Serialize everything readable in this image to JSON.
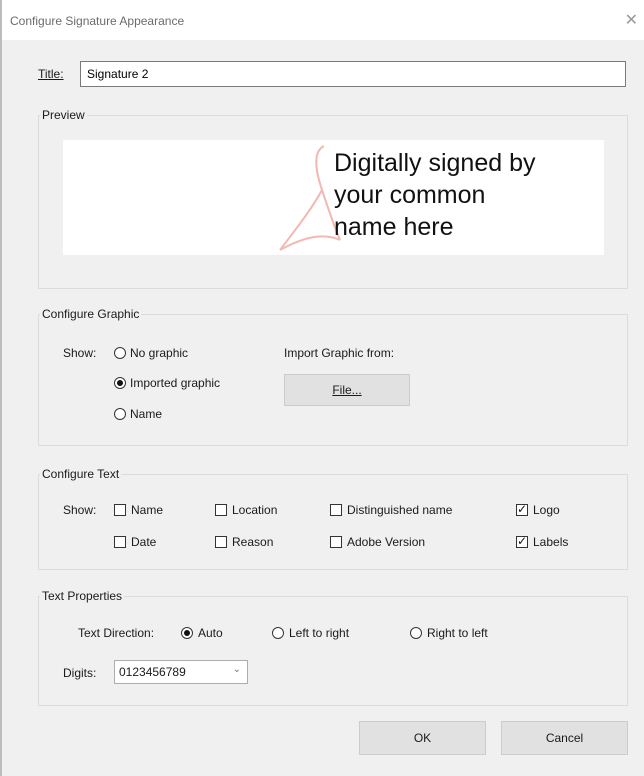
{
  "window": {
    "title": "Configure Signature Appearance"
  },
  "title_field": {
    "label": "Title:",
    "value": "Signature 2"
  },
  "preview": {
    "label": "Preview",
    "text_lines": [
      "Digitally signed by",
      "your common",
      "name here"
    ]
  },
  "configure_graphic": {
    "label": "Configure Graphic",
    "show_label": "Show:",
    "options": [
      {
        "label": "No graphic",
        "selected": false
      },
      {
        "label": "Imported graphic",
        "selected": true
      },
      {
        "label": "Name",
        "selected": false
      }
    ],
    "import_label": "Import Graphic from:",
    "file_button": "File..."
  },
  "configure_text": {
    "label": "Configure Text",
    "show_label": "Show:",
    "items": [
      {
        "label": "Name",
        "checked": false
      },
      {
        "label": "Location",
        "checked": false
      },
      {
        "label": "Distinguished name",
        "checked": false
      },
      {
        "label": "Logo",
        "checked": true
      },
      {
        "label": "Date",
        "checked": false
      },
      {
        "label": "Reason",
        "checked": false
      },
      {
        "label": "Adobe Version",
        "checked": false
      },
      {
        "label": "Labels",
        "checked": true
      }
    ]
  },
  "text_properties": {
    "label": "Text Properties",
    "direction_label": "Text Direction:",
    "directions": [
      {
        "label": "Auto",
        "selected": true
      },
      {
        "label": "Left to right",
        "selected": false
      },
      {
        "label": "Right to left",
        "selected": false
      }
    ],
    "digits_label": "Digits:",
    "digits_value": "0123456789"
  },
  "buttons": {
    "ok": "OK",
    "cancel": "Cancel"
  },
  "colors": {
    "logo": "#f2b8b2",
    "button_bg": "#e1e1e1",
    "dialog_bg": "#f0f0f0"
  }
}
